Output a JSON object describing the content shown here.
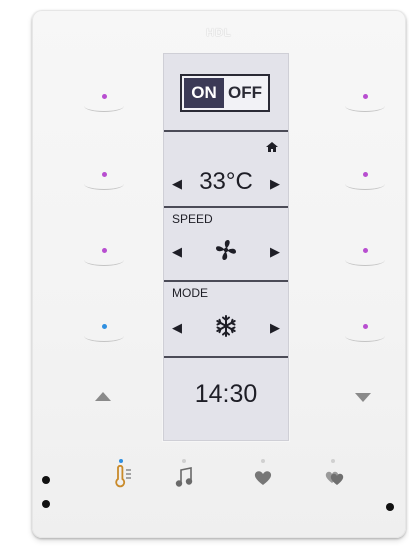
{
  "panel": {
    "brand": "HDL",
    "power": {
      "on_label": "ON",
      "off_label": "OFF",
      "state": "on"
    },
    "temperature": {
      "value": "33°C",
      "icon": "home-icon"
    },
    "speed": {
      "label": "SPEED",
      "icon": "fan-icon"
    },
    "mode": {
      "label": "MODE",
      "icon": "snowflake-icon"
    },
    "time": "14:30",
    "left_keys": [
      {
        "indicator": "#b84ed0"
      },
      {
        "indicator": "#b84ed0"
      },
      {
        "indicator": "#b84ed0"
      },
      {
        "indicator": "#2f8fe0"
      }
    ],
    "right_keys": [
      {
        "indicator": "#b84ed0"
      },
      {
        "indicator": "#b84ed0"
      },
      {
        "indicator": "#b84ed0"
      },
      {
        "indicator": "#b84ed0"
      }
    ],
    "page_buttons": [
      {
        "icon": "thermometer-icon",
        "active": true,
        "indicator": "#2f8fe0"
      },
      {
        "icon": "music-note-icon",
        "active": false
      },
      {
        "icon": "heart-icon",
        "active": false
      },
      {
        "icon": "double-heart-icon",
        "active": false
      }
    ]
  }
}
